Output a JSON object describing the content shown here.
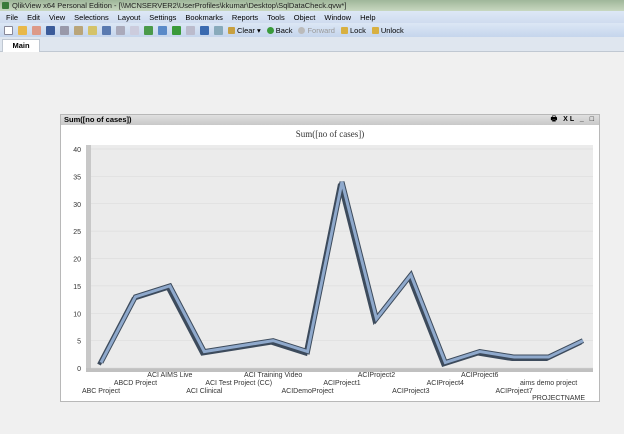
{
  "window": {
    "title": "QlikView x64 Personal Edition - [\\\\MCNSERVER2\\UserProfiles\\kkumar\\Desktop\\SqlDataCheck.qvw*]"
  },
  "menu": [
    "File",
    "Edit",
    "View",
    "Selections",
    "Layout",
    "Settings",
    "Bookmarks",
    "Reports",
    "Tools",
    "Object",
    "Window",
    "Help"
  ],
  "toolbar": {
    "clear": "Clear ▾",
    "back": "Back",
    "forward": "Forward",
    "lock": "Lock",
    "unlock": "Unlock"
  },
  "tabs": [
    {
      "label": "Main"
    }
  ],
  "chart_object": {
    "caption": "Sum([no of cases])",
    "icons": "🖶 XL _ □"
  },
  "chart_data": {
    "type": "line",
    "title": "Sum([no of cases])",
    "xlabel": "PROJECTNAME",
    "ylabel": "",
    "ylim": [
      0,
      40
    ],
    "yticks": [
      0,
      5,
      10,
      15,
      20,
      25,
      30,
      35,
      40
    ],
    "categories": [
      "ABC Project",
      "ABCD Project",
      "ACI AIMS Live",
      "ACI Clinical",
      "ACI Test Project (CC)",
      "ACI Training Video",
      "ACIDemoProject",
      "ACIProject1",
      "ACIProject2",
      "ACIProject3",
      "ACIProject4",
      "ACIProject6",
      "ACIProject7",
      "aims demo project",
      ""
    ],
    "values": [
      1,
      13,
      15,
      3,
      4,
      5,
      3,
      34,
      9,
      17,
      1,
      3,
      2,
      2,
      5
    ],
    "grid": true
  }
}
